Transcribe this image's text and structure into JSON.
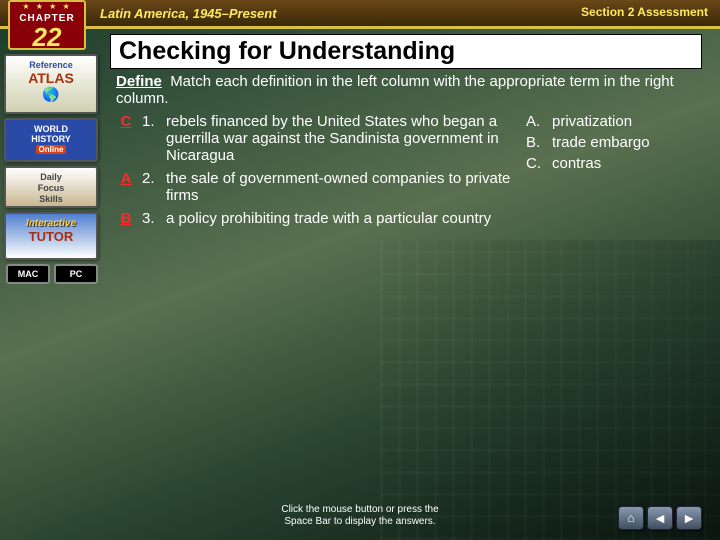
{
  "header": {
    "chapter_label": "CHAPTER",
    "chapter_number": "22",
    "unit_title": "Latin America, 1945–Present",
    "section_label": "Section 2 Assessment"
  },
  "sidebar": {
    "atlas_ref": "Reference",
    "atlas_word": "ATLAS",
    "who_line1": "WORLD",
    "who_line2": "HISTORY",
    "who_line3": "Online",
    "dfs_line1": "Daily",
    "dfs_line2": "Focus",
    "dfs_line3": "Skills",
    "tutor_line1": "Interactive",
    "tutor_line2": "TUTOR",
    "platform_mac": "MAC",
    "platform_pc": "PC"
  },
  "content": {
    "title": "Checking for Understanding",
    "define_label": "Define",
    "define_instructions": "Match each definition in the left column with the appropriate term in the right column.",
    "questions": [
      {
        "answer": "C",
        "num": "1.",
        "text": "rebels financed by the United States who began a guerrilla war against the Sandinista government in Nicaragua"
      },
      {
        "answer": "A",
        "num": "2.",
        "text": "the sale of government-owned companies to private firms"
      },
      {
        "answer": "B",
        "num": "3.",
        "text": "a policy prohibiting trade with a particular country"
      }
    ],
    "options": [
      {
        "letter": "A.",
        "term": "privatization"
      },
      {
        "letter": "B.",
        "term": "trade embargo"
      },
      {
        "letter": "C.",
        "term": "contras"
      }
    ]
  },
  "footer": {
    "hint_line1": "Click the mouse button or press the",
    "hint_line2": "Space Bar to display the answers."
  }
}
